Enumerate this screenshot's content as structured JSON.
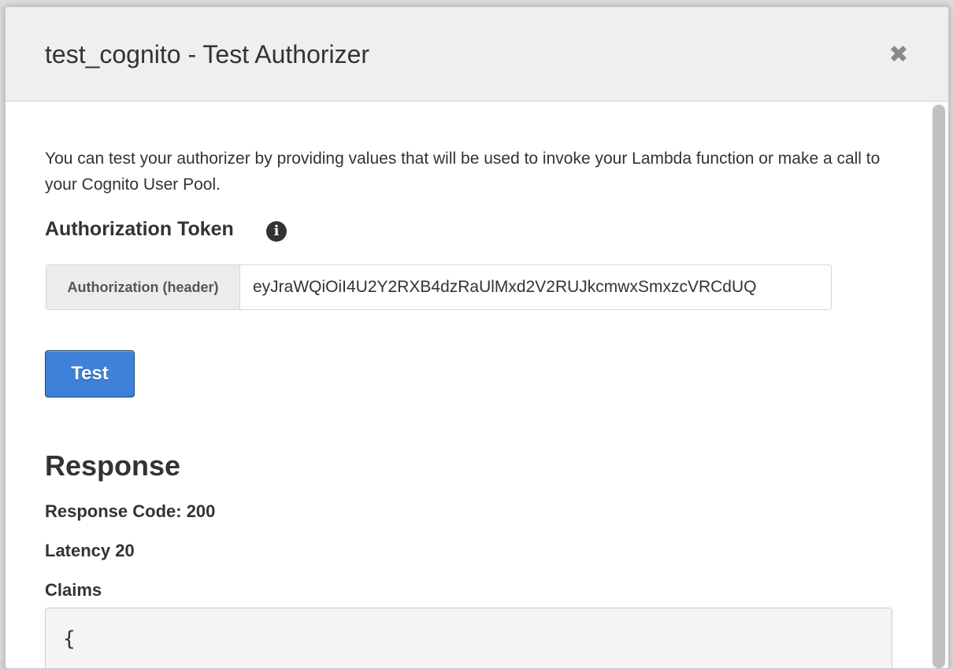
{
  "modal": {
    "title": "test_cognito - Test Authorizer",
    "close_glyph": "✖",
    "description": "You can test your authorizer by providing values that will be used to invoke your Lambda function or make a call to your Cognito User Pool.",
    "token_heading": "Authorization Token",
    "info_icon": "i",
    "token": {
      "addon_label": "Authorization (header)",
      "value": "eyJraWQiOiI4U2Y2RXB4dzRaUlMxd2V2RUJkcmwxSmxzcVRCdUQ"
    },
    "test_button_label": "Test",
    "response": {
      "heading": "Response",
      "code_line": "Response Code: 200",
      "latency_line": "Latency 20",
      "claims_label": "Claims",
      "claims_text": "{"
    }
  },
  "icons": {
    "close": "close-icon",
    "info": "info-icon"
  },
  "colors": {
    "primary_button": "#3f80d8",
    "header_bg": "#efefef"
  }
}
